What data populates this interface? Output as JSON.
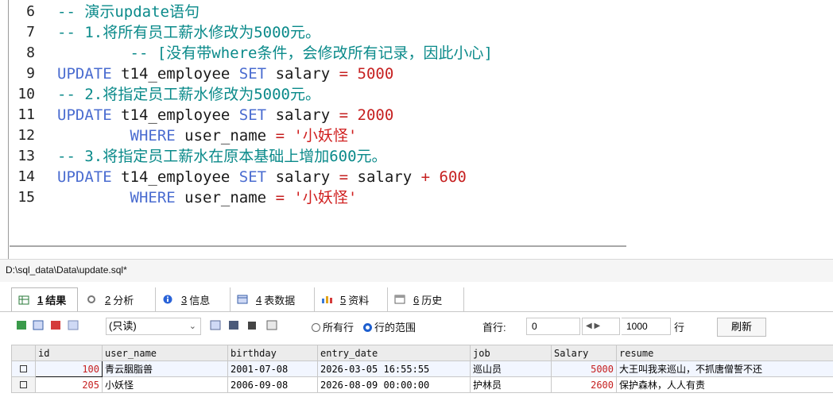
{
  "editor": {
    "line_numbers": [
      "6",
      "7",
      "8",
      "9",
      "10",
      "11",
      "12",
      "13",
      "14",
      "15"
    ],
    "lines": [
      {
        "c": "-- 演示update语句"
      },
      {
        "c": "-- 1.将所有员工薪水修改为5000元。"
      },
      {
        "c": "        -- [没有带where条件，会修改所有记录，因此小心]"
      },
      {
        "kw1": "UPDATE",
        "t1": " t14_employee ",
        "kw2": "SET",
        "t2": " salary ",
        "op": "=",
        "t3": " ",
        "n": "5000"
      },
      {
        "c": "-- 2.将指定员工薪水修改为5000元。"
      },
      {
        "kw1": "UPDATE",
        "t1": " t14_employee ",
        "kw2": "SET",
        "t2": " salary ",
        "op": "=",
        "t3": " ",
        "n": "2000"
      },
      {
        "pad": "        ",
        "kw1": "WHERE",
        "t1": " user_name ",
        "op": "=",
        "t2": " ",
        "s": "'小妖怪'"
      },
      {
        "c": "-- 3.将指定员工薪水在原本基础上增加600元。"
      },
      {
        "kw1": "UPDATE",
        "t1": " t14_employee ",
        "kw2": "SET",
        "t2": " salary ",
        "op": "=",
        "t3": " salary ",
        "op2": "+",
        "t4": " ",
        "n": "600"
      },
      {
        "pad": "        ",
        "kw1": "WHERE",
        "t1": " user_name ",
        "op": "=",
        "t2": " ",
        "s": "'小妖怪'"
      }
    ]
  },
  "file_path": "D:\\sql_data\\Data\\update.sql*",
  "tabs": [
    {
      "num": "1",
      "label": "结果",
      "icon": "grid-icon"
    },
    {
      "num": "2",
      "label": "分析",
      "icon": "analyze-icon"
    },
    {
      "num": "3",
      "label": "信息",
      "icon": "info-icon"
    },
    {
      "num": "4",
      "label": "表数据",
      "icon": "table-icon"
    },
    {
      "num": "5",
      "label": "资料",
      "icon": "profile-icon"
    },
    {
      "num": "6",
      "label": "历史",
      "icon": "history-icon"
    }
  ],
  "toolbar": {
    "mode": "(只读)",
    "radio_all": "所有行",
    "radio_range": "行的范围",
    "first_row_label": "首行:",
    "first_row_value": "0",
    "rows_value": "1000",
    "rows_label": "行",
    "refresh": "刷新"
  },
  "grid": {
    "columns": [
      "id",
      "user_name",
      "birthday",
      "entry_date",
      "job",
      "Salary",
      "resume"
    ],
    "rows": [
      [
        "100",
        "青云胭脂兽",
        "2001-07-08",
        "2026-03-05 16:55:55",
        "巡山员",
        "5000",
        "大王叫我来巡山，不抓唐僧誓不还"
      ],
      [
        "205",
        "小妖怪",
        "2006-09-08",
        "2026-08-09 00:00:00",
        "护林员",
        "2600",
        "保护森林，人人有责"
      ]
    ]
  },
  "colors": {
    "comment": "#0a8a8a",
    "keyword": "#4a6cd0",
    "number": "#c62020",
    "string": "#d01f1f"
  }
}
